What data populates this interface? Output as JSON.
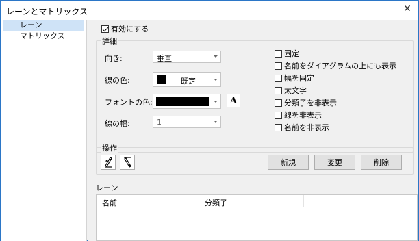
{
  "window": {
    "title": "レーンとマトリックス",
    "close_glyph": "✕"
  },
  "sidebar": {
    "items": [
      {
        "label": "レーン"
      },
      {
        "label": "マトリックス"
      }
    ]
  },
  "enable": {
    "label": "有効にする",
    "checked": true
  },
  "details": {
    "legend": "詳細",
    "orientation": {
      "label": "向き:",
      "value": "垂直"
    },
    "line_color": {
      "label": "線の色:",
      "value": "既定"
    },
    "font_color": {
      "label": "フォントの色:",
      "font_button": "A"
    },
    "line_width": {
      "label": "線の幅:",
      "value": "1"
    },
    "options": [
      {
        "label": "固定",
        "checked": false
      },
      {
        "label": "名前をダイアグラムの上にも表示",
        "checked": false
      },
      {
        "label": "幅を固定",
        "checked": false
      },
      {
        "label": "太文字",
        "checked": false
      },
      {
        "label": "分類子を非表示",
        "checked": false
      },
      {
        "label": "線を非表示",
        "checked": false
      },
      {
        "label": "名前を非表示",
        "checked": false
      }
    ]
  },
  "operations": {
    "legend": "操作",
    "new_label": "新規",
    "change_label": "変更",
    "delete_label": "削除"
  },
  "lanes": {
    "heading": "レーン",
    "columns": [
      "名前",
      "分類子"
    ]
  }
}
